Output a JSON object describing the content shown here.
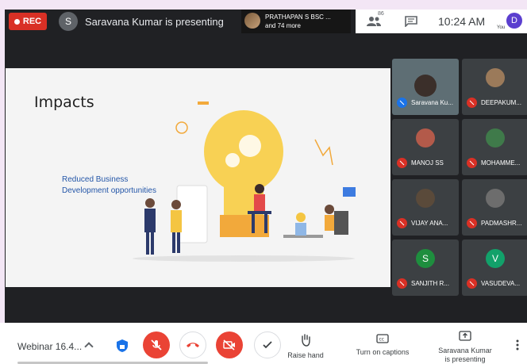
{
  "top": {
    "rec_label": "REC",
    "presenter_initial": "S",
    "presenting_text": "Saravana Kumar is presenting",
    "participant_name": "PRATHAPAN S BSC ...",
    "participant_more": "and 74 more",
    "people_count": "86",
    "clock": "10:24 AM",
    "you_initial": "D",
    "you_label": "You"
  },
  "slide": {
    "title": "Impacts",
    "subtitle_line1": "Reduced Business",
    "subtitle_line2": "Development opportunities"
  },
  "tiles": [
    {
      "name": "Saravana Ku...",
      "kind": "video"
    },
    {
      "name": "DEEPAKUM...",
      "kind": "photo"
    },
    {
      "name": "MANOJ SS",
      "kind": "photo"
    },
    {
      "name": "MOHAMME...",
      "kind": "photo"
    },
    {
      "name": "VIJAY ANA...",
      "kind": "photo"
    },
    {
      "name": "PADMASHR...",
      "kind": "photo"
    },
    {
      "name": "SANJITH R...",
      "kind": "letter",
      "initial": "S",
      "color": "#1e8e3e"
    },
    {
      "name": "VASUDEVA...",
      "kind": "letter",
      "initial": "V",
      "color": "#12a16a"
    }
  ],
  "bottom": {
    "meeting_name": "Webinar 16.4...",
    "raise_hand": "Raise hand",
    "captions": "Turn on captions",
    "presenting_line1": "Saravana Kumar",
    "presenting_line2": "is presenting"
  },
  "colors": {
    "accent_red": "#ea4335",
    "rec_red": "#d93025",
    "dark_bg": "#202124"
  }
}
